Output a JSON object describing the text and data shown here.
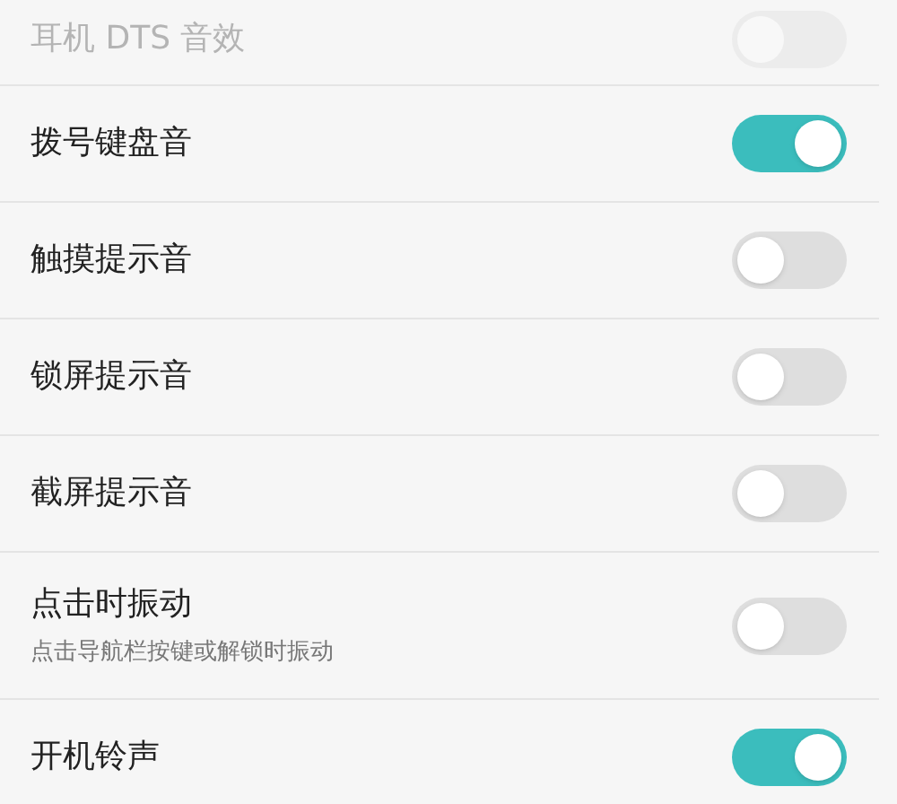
{
  "settings": [
    {
      "label": "耳机 DTS 音效",
      "on": false,
      "disabled": true
    },
    {
      "label": "拨号键盘音",
      "on": true,
      "disabled": false
    },
    {
      "label": "触摸提示音",
      "on": false,
      "disabled": false
    },
    {
      "label": "锁屏提示音",
      "on": false,
      "disabled": false
    },
    {
      "label": "截屏提示音",
      "on": false,
      "disabled": false
    },
    {
      "label": "点击时振动",
      "description": "点击导航栏按键或解锁时振动",
      "on": false,
      "disabled": false
    },
    {
      "label": "开机铃声",
      "on": true,
      "disabled": false
    }
  ]
}
